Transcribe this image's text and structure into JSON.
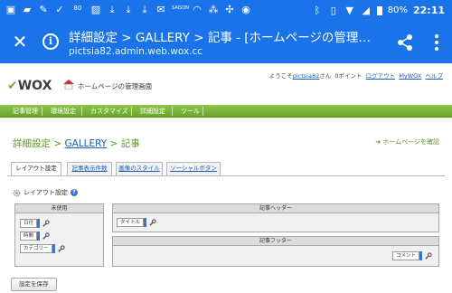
{
  "status_bar": {
    "left_icons": [
      "photo-icon",
      "folder-icon",
      "wrench-icon",
      "check-icon",
      "battery-80-icon",
      "image-icon",
      "download-icon",
      "download-icon",
      "download-icon",
      "gmail-icon",
      "saison-icon",
      "car-icon",
      "network-icon",
      "game-icon",
      "camera-icon"
    ],
    "badge_80": "80",
    "badge_saison": "SAISON",
    "right_icons": [
      "bluetooth-icon",
      "vibrate-icon",
      "wifi-icon",
      "signal-icon"
    ],
    "battery_pct": "80%",
    "time": "22:11"
  },
  "app_bar": {
    "title": "詳細設定 > GALLERY > 記事 - [ホームページの管理画面]...",
    "url": "pictsia82.admin.web.wox.cc"
  },
  "header": {
    "welcome_prefix": "ようこそ",
    "username": "pictsia82",
    "welcome_suffix": "さん",
    "points": "0ポイント",
    "logout": "ログアウト",
    "mywox": "MyWOX",
    "help": "ヘルプ",
    "logo_text": "WOX",
    "logo_subtitle": "ホームページの管理画面"
  },
  "nav": {
    "items": [
      "記事管理",
      "環境設定",
      "カスタマイズ",
      "詳細設定",
      "ツール"
    ]
  },
  "page": {
    "breadcrumb_root": "詳細設定",
    "breadcrumb_sep": ">",
    "breadcrumb_gallery": "GALLERY",
    "breadcrumb_current": "記事",
    "home_confirm": "ホームページを確認"
  },
  "tabs": [
    "レイアウト設定",
    "記事表示件数",
    "画像のスタイル",
    "ソーシャルボタン"
  ],
  "layout": {
    "label": "レイアウト設定",
    "help": "?",
    "unused": {
      "header": "未使用",
      "parts": [
        "日付",
        "時間",
        "カテゴリー"
      ]
    },
    "article_header": {
      "header": "記事ヘッダー",
      "parts": [
        "タイトル"
      ]
    },
    "article_footer": {
      "header": "記事フッター",
      "parts": [
        "コメント"
      ]
    }
  },
  "save_button": "設定を保存"
}
